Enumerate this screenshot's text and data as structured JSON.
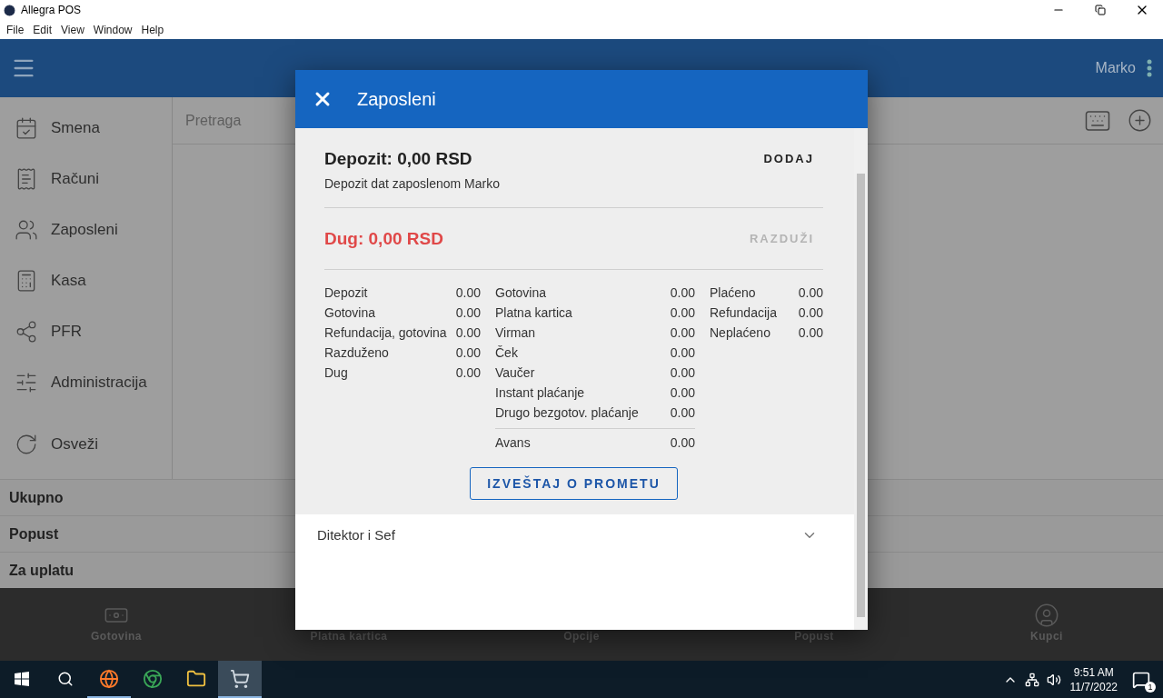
{
  "window": {
    "title": "Allegra POS"
  },
  "menu_bar": [
    "File",
    "Edit",
    "View",
    "Window",
    "Help"
  ],
  "header": {
    "user": "Marko"
  },
  "sidebar": {
    "items": [
      {
        "label": "Smena"
      },
      {
        "label": "Računi"
      },
      {
        "label": "Zaposleni"
      },
      {
        "label": "Kasa"
      },
      {
        "label": "PFR"
      },
      {
        "label": "Administracija"
      },
      {
        "label": "Osveži"
      }
    ]
  },
  "search": {
    "placeholder": "Pretraga"
  },
  "summary": [
    "Ukupno",
    "Popust",
    "Za uplatu"
  ],
  "bottom_nav": [
    {
      "label": "Gotovina"
    },
    {
      "label": "Platna kartica"
    },
    {
      "label": "Opcije"
    },
    {
      "label": "Popust"
    },
    {
      "label": "Kupci"
    }
  ],
  "dialog": {
    "title": "Zaposleni",
    "deposit": {
      "title": "Depozit: 0,00 RSD",
      "subtitle": "Depozit dat zaposlenom Marko",
      "action": "DODAJ",
      "disabled": false
    },
    "debt": {
      "title": "Dug: 0,00 RSD",
      "action": "RAZDUŽI",
      "disabled": true
    },
    "columns": [
      {
        "rows": [
          {
            "label": "Depozit",
            "value": "0.00"
          },
          {
            "label": "Gotovina",
            "value": "0.00"
          },
          {
            "label": "Refundacija, gotovina",
            "value": "0.00"
          },
          {
            "label": "Razduženo",
            "value": "0.00"
          },
          {
            "label": "Dug",
            "value": "0.00"
          }
        ]
      },
      {
        "rows": [
          {
            "label": "Gotovina",
            "value": "0.00"
          },
          {
            "label": "Platna kartica",
            "value": "0.00"
          },
          {
            "label": "Virman",
            "value": "0.00"
          },
          {
            "label": "Ček",
            "value": "0.00"
          },
          {
            "label": "Vaučer",
            "value": "0.00"
          },
          {
            "label": "Instant plaćanje",
            "value": "0.00"
          },
          {
            "label": "Drugo bezgotov. plaćanje",
            "value": "0.00"
          }
        ],
        "footer": {
          "label": "Avans",
          "value": "0.00"
        }
      },
      {
        "rows": [
          {
            "label": "Plaćeno",
            "value": "0.00"
          },
          {
            "label": "Refundacija",
            "value": "0.00"
          },
          {
            "label": "Neplaćeno",
            "value": "0.00"
          }
        ]
      }
    ],
    "report_button": "IZVEŠTAJ O PROMETU",
    "panel": {
      "title": "Ditektor i Sef",
      "expanded": false
    }
  },
  "taskbar": {
    "apps": [
      {
        "selected": false,
        "running": true
      },
      {
        "selected": false,
        "running": false
      },
      {
        "selected": false,
        "running": false
      },
      {
        "selected": true,
        "running": true
      }
    ],
    "time": "9:51 AM",
    "date": "11/7/2022",
    "notifications": "1"
  }
}
